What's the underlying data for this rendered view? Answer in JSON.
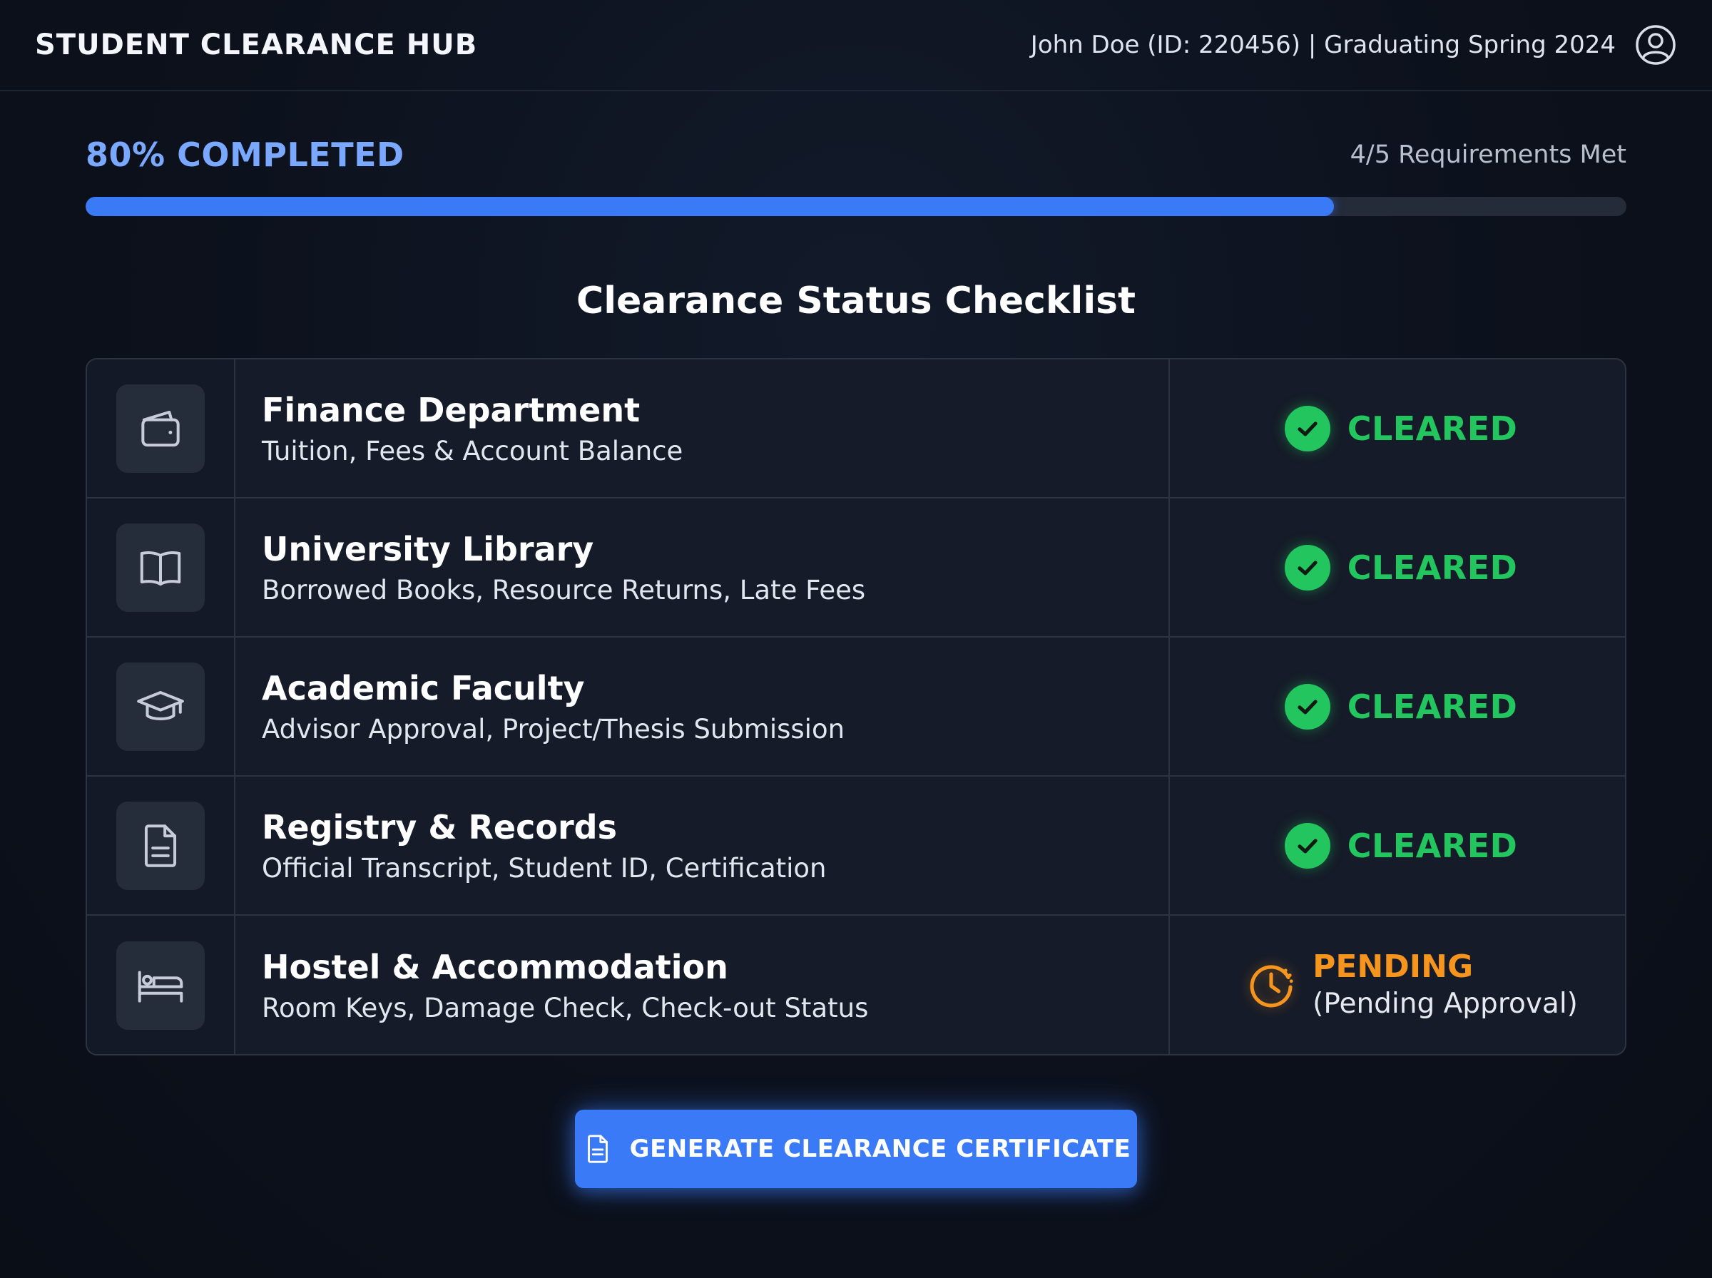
{
  "header": {
    "brand": "STUDENT CLEARANCE HUB",
    "user_info": "John Doe (ID: 220456) | Graduating Spring 2024",
    "avatar_icon": "user-circle-icon"
  },
  "progress": {
    "title": "80% COMPLETED",
    "meta": "4/5 Requirements Met",
    "percent": 81
  },
  "checklist": {
    "title": "Clearance Status Checklist",
    "items": [
      {
        "icon": "wallet-icon",
        "name": "Finance Department",
        "description": "Tuition, Fees & Account Balance",
        "status": "CLEARED"
      },
      {
        "icon": "book-icon",
        "name": "University Library",
        "description": "Borrowed Books, Resource Returns, Late Fees",
        "status": "CLEARED"
      },
      {
        "icon": "graduation-cap-icon",
        "name": "Academic Faculty",
        "description": "Advisor Approval, Project/Thesis Submission",
        "status": "CLEARED"
      },
      {
        "icon": "document-icon",
        "name": "Registry & Records",
        "description": "Official Transcript, Student ID, Certification",
        "status": "CLEARED"
      },
      {
        "icon": "bed-icon",
        "name": "Hostel & Accommodation",
        "description": "Room Keys, Damage Check, Check-out Status",
        "status": "PENDING",
        "status_note": "(Pending Approval)"
      }
    ]
  },
  "actions": {
    "generate_label": "GENERATE CLEARANCE CERTIFICATE",
    "generate_icon": "document-icon"
  },
  "colors": {
    "accent": "#3b7af6",
    "progress_title": "#7aa8ff",
    "cleared": "#22c55e",
    "pending": "#f5951e",
    "background": "#0b0f19"
  }
}
